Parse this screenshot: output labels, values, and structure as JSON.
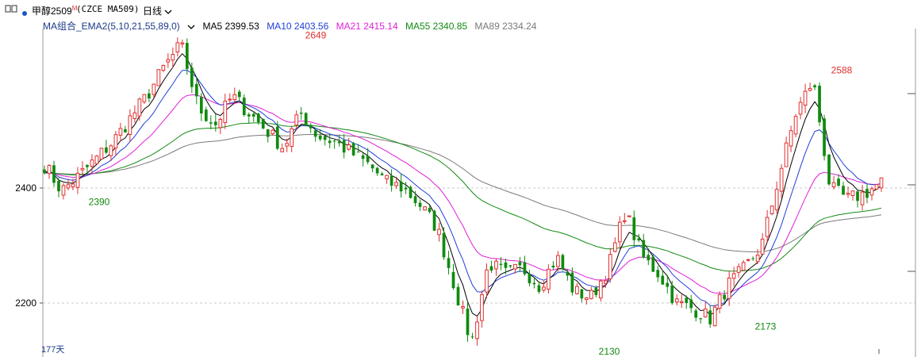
{
  "toolbar": {
    "menu_icon": "window-icon",
    "symbol": "甲醇2509",
    "superscript": "M",
    "contract": "(CZCE MA509)",
    "period": "日线",
    "period_dropdown": "chevron-down-icon"
  },
  "indicator": {
    "name": "MA组合_EMA2(5,10,21,55,89,0)",
    "dropdown": "chevron-down-icon",
    "ma5": "MA5 2399.53",
    "ma10": "MA10 2403.56",
    "ma21": "MA21 2415.14",
    "ma55": "MA55 2340.85",
    "ma89": "MA89 2334.24"
  },
  "colors": {
    "ma5": "#000000",
    "ma10": "#1f3fd8",
    "ma21": "#e020d8",
    "ma55": "#138a13",
    "ma89": "#7a7a7a",
    "up": "#e03030",
    "down": "#108a10"
  },
  "footer": {
    "days": "177天"
  },
  "chart_data": {
    "type": "candlestick",
    "y_ticks": [
      2200,
      2400
    ],
    "ylim": [
      2120,
      2670
    ],
    "annotations": [
      {
        "label": "2649",
        "value": 2649,
        "kind": "high"
      },
      {
        "label": "2390",
        "value": 2390,
        "kind": "low"
      },
      {
        "label": "2588",
        "value": 2588,
        "kind": "high"
      },
      {
        "label": "2130",
        "value": 2130,
        "kind": "low"
      },
      {
        "label": "2173",
        "value": 2173,
        "kind": "low"
      }
    ],
    "trend_anchors": [
      2440,
      2395,
      2420,
      2450,
      2480,
      2520,
      2560,
      2610,
      2649,
      2540,
      2510,
      2560,
      2530,
      2500,
      2470,
      2530,
      2490,
      2480,
      2460,
      2440,
      2410,
      2400,
      2370,
      2330,
      2230,
      2130,
      2270,
      2250,
      2260,
      2230,
      2280,
      2220,
      2210,
      2260,
      2360,
      2280,
      2250,
      2200,
      2190,
      2173,
      2230,
      2260,
      2300,
      2420,
      2530,
      2588,
      2400,
      2380,
      2390,
      2410
    ],
    "series": [
      {
        "name": "MA5",
        "value": 2399.53
      },
      {
        "name": "MA10",
        "value": 2403.56
      },
      {
        "name": "MA21",
        "value": 2415.14
      },
      {
        "name": "MA55",
        "value": 2340.85
      },
      {
        "name": "MA89",
        "value": 2334.24
      }
    ]
  }
}
